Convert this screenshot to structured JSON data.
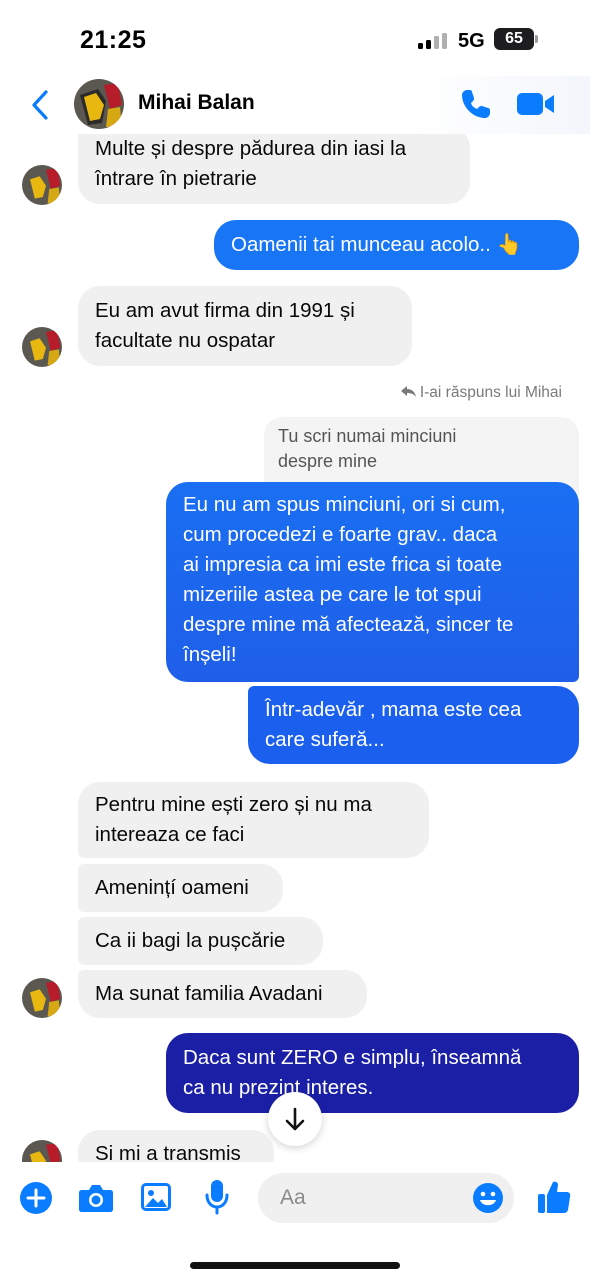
{
  "status_bar": {
    "time": "21:25",
    "network": "5G",
    "battery": "65"
  },
  "header": {
    "contact_name": "Mihai Balan",
    "icons": [
      "back-chevron-icon",
      "phone-icon",
      "video-camera-icon"
    ]
  },
  "messages": [
    {
      "side": "in",
      "text_lines": [
        "Multe și despre pădurea din iasi la",
        "întrare în pietrarie"
      ]
    },
    {
      "side": "out",
      "text": "Oamenii tai munceau acolo.. 👆"
    },
    {
      "side": "in",
      "text_lines": [
        "Eu am  avut firma din 1991 și",
        "facultate nu ospatar"
      ]
    },
    {
      "reply_label": "I-ai răspuns lui Mihai",
      "quoted_lines": [
        "Tu scri numai minciuni",
        "despre mine"
      ]
    },
    {
      "side": "out",
      "text_lines": [
        "Eu nu am spus minciuni, ori si cum,",
        "cum procedezi e foarte grav.. daca",
        "ai impresia ca imi este frica si toate",
        "mizeriile astea pe care le tot spui",
        "despre mine mă afectează, sincer te",
        "înșeli!"
      ]
    },
    {
      "side": "out",
      "text_lines": [
        "Într-adevăr , mama este cea",
        "care suferă..."
      ]
    },
    {
      "side": "in",
      "text_lines": [
        "Pentru mine ești zero și nu ma",
        "intereaza ce faci"
      ]
    },
    {
      "side": "in",
      "text": "Amenințí oameni"
    },
    {
      "side": "in",
      "text": "Ca ii bagi la pușcărie"
    },
    {
      "side": "in",
      "text": "Ma sunat familia Avadani"
    },
    {
      "side": "out",
      "text_lines": [
        "Daca sunt ZERO e simplu, înseamnă",
        "ca nu prezint interes."
      ]
    },
    {
      "side": "in",
      "text": "Si mi a transmis"
    }
  ],
  "composer": {
    "placeholder": "Aa",
    "icons": [
      "plus-icon",
      "camera-icon",
      "gallery-icon",
      "microphone-icon",
      "emoji-icon",
      "thumbs-up-icon"
    ]
  },
  "colors": {
    "accent": "#0a7cff",
    "outgoing_top": "#1f8cf7",
    "outgoing_bottom": "#1b1fa6",
    "incoming": "#f0f0f0"
  }
}
